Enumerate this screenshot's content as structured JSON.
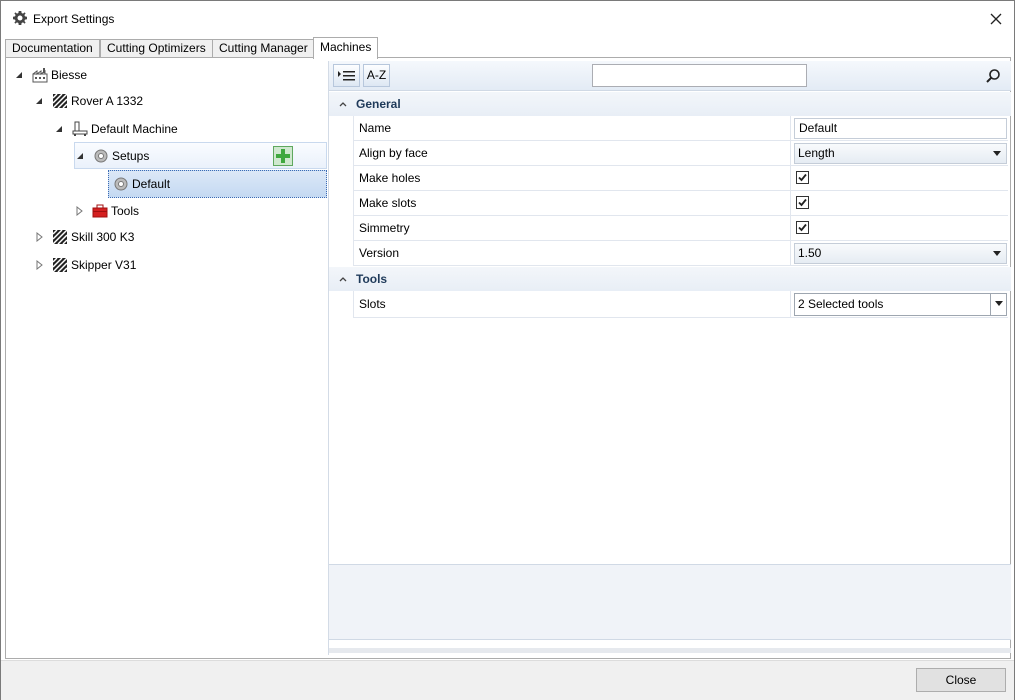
{
  "window": {
    "title": "Export Settings"
  },
  "tabs": [
    {
      "label": "Documentation"
    },
    {
      "label": "Cutting Optimizers"
    },
    {
      "label": "Cutting Manager"
    },
    {
      "label": "Machines"
    }
  ],
  "tree": {
    "biesse": "Biesse",
    "rover": "Rover A 1332",
    "default_machine": "Default Machine",
    "setups": "Setups",
    "default": "Default",
    "tools": "Tools",
    "skill": "Skill 300 K3",
    "skipper": "Skipper V31"
  },
  "toolbar": {
    "categorized_label": "",
    "az_label": "A-Z",
    "search_value": ""
  },
  "property_grid": {
    "general": {
      "title": "General",
      "name_label": "Name",
      "name_value": "Default",
      "align_label": "Align by face",
      "align_value": "Length",
      "holes_label": "Make holes",
      "holes_checked": true,
      "slots_label": "Make slots",
      "slots_checked": true,
      "simmetry_label": "Simmetry",
      "simmetry_checked": true,
      "version_label": "Version",
      "version_value": "1.50"
    },
    "tools": {
      "title": "Tools",
      "slots_label": "Slots",
      "slots_value": "2 Selected tools"
    }
  },
  "footer": {
    "close_label": "Close"
  }
}
